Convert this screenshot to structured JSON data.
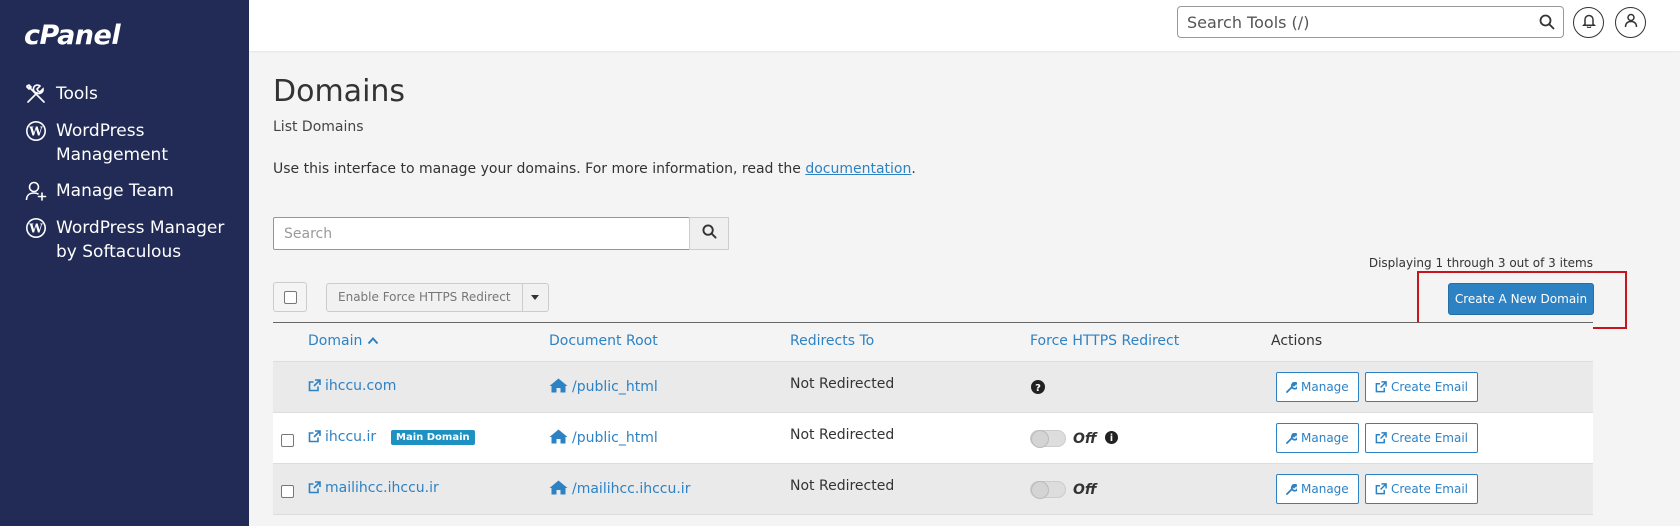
{
  "app": {
    "logo": "cPanel"
  },
  "sidebar": {
    "items": [
      {
        "label": "Tools",
        "icon": "tools-icon"
      },
      {
        "label": "WordPress Management",
        "icon": "wordpress-icon"
      },
      {
        "label": "Manage Team",
        "icon": "add-user-icon"
      },
      {
        "label": "WordPress Manager by Softaculous",
        "icon": "wordpress-icon"
      }
    ]
  },
  "topbar": {
    "search_placeholder": "Search Tools (/)"
  },
  "page": {
    "title": "Domains",
    "subtitle": "List Domains",
    "description": "Use this interface to manage your domains. For more information, read the ",
    "doc_link": "documentation",
    "description_end": ".",
    "search_placeholder": "Search",
    "displaying": "Displaying 1 through 3 out of 3 items",
    "force_https_button": "Enable Force HTTPS Redirect",
    "create_button": "Create A New Domain"
  },
  "table": {
    "headers": {
      "domain": "Domain",
      "docroot": "Document Root",
      "redirects": "Redirects To",
      "force_https": "Force HTTPS Redirect",
      "actions": "Actions"
    },
    "rows": [
      {
        "domain": "ihccu.com",
        "badge": "",
        "docroot": "/public_html",
        "redirects": "Not Redirected",
        "force": "",
        "manage": "Manage",
        "email": "Create Email"
      },
      {
        "domain": "ihccu.ir",
        "badge": "Main Domain",
        "docroot": "/public_html",
        "redirects": "Not Redirected",
        "force": "Off",
        "manage": "Manage",
        "email": "Create Email"
      },
      {
        "domain": "mailihcc.ihccu.ir",
        "badge": "",
        "docroot": "/mailihcc.ihccu.ir",
        "redirects": "Not Redirected",
        "force": "Off",
        "manage": "Manage",
        "email": "Create Email"
      }
    ]
  },
  "colors": {
    "sidebar": "#212b55",
    "accent": "#2d82c4",
    "highlight": "#c8151b"
  }
}
